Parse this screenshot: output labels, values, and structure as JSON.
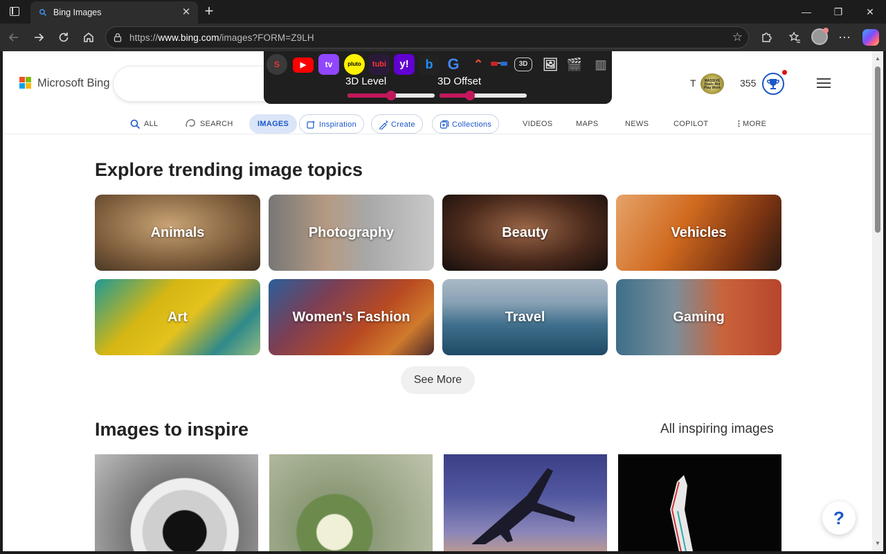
{
  "browser": {
    "tab_title": "Bing Images",
    "tab_close": "✕",
    "new_tab": "+",
    "url_prefix": "https://",
    "url_host": "www.bing.com",
    "url_path": "/images?FORM=Z9LH",
    "window_controls": {
      "minimize": "—",
      "restore": "❐",
      "close": "✕"
    }
  },
  "extension": {
    "icons": [
      "S",
      "▶",
      "tv",
      "pluto",
      "tubi",
      "y!",
      "b",
      "G",
      "⌃",
      "3D",
      "🖼",
      "🎬",
      "▥"
    ],
    "level_label": "3D Level",
    "offset_label": "3D Offset",
    "level_value": 0.5,
    "offset_value": 0.35
  },
  "header": {
    "logo_text": "Microsoft Bing",
    "user_initial": "T",
    "badge_text": "MASSIVE Deals Bid Play Work",
    "points": "355"
  },
  "nav": {
    "all": "ALL",
    "search": "SEARCH",
    "images": "IMAGES",
    "inspiration": "Inspiration",
    "create": "Create",
    "collections": "Collections",
    "videos": "VIDEOS",
    "maps": "MAPS",
    "news": "NEWS",
    "copilot": "COPILOT",
    "more": "MORE"
  },
  "trending": {
    "heading": "Explore trending image topics",
    "topics": [
      "Animals",
      "Photography",
      "Beauty",
      "Vehicles",
      "Art",
      "Women's Fashion",
      "Travel",
      "Gaming"
    ],
    "see_more": "See More"
  },
  "inspire": {
    "heading": "Images to inspire",
    "all_link": "All inspiring images"
  },
  "help_label": "?"
}
